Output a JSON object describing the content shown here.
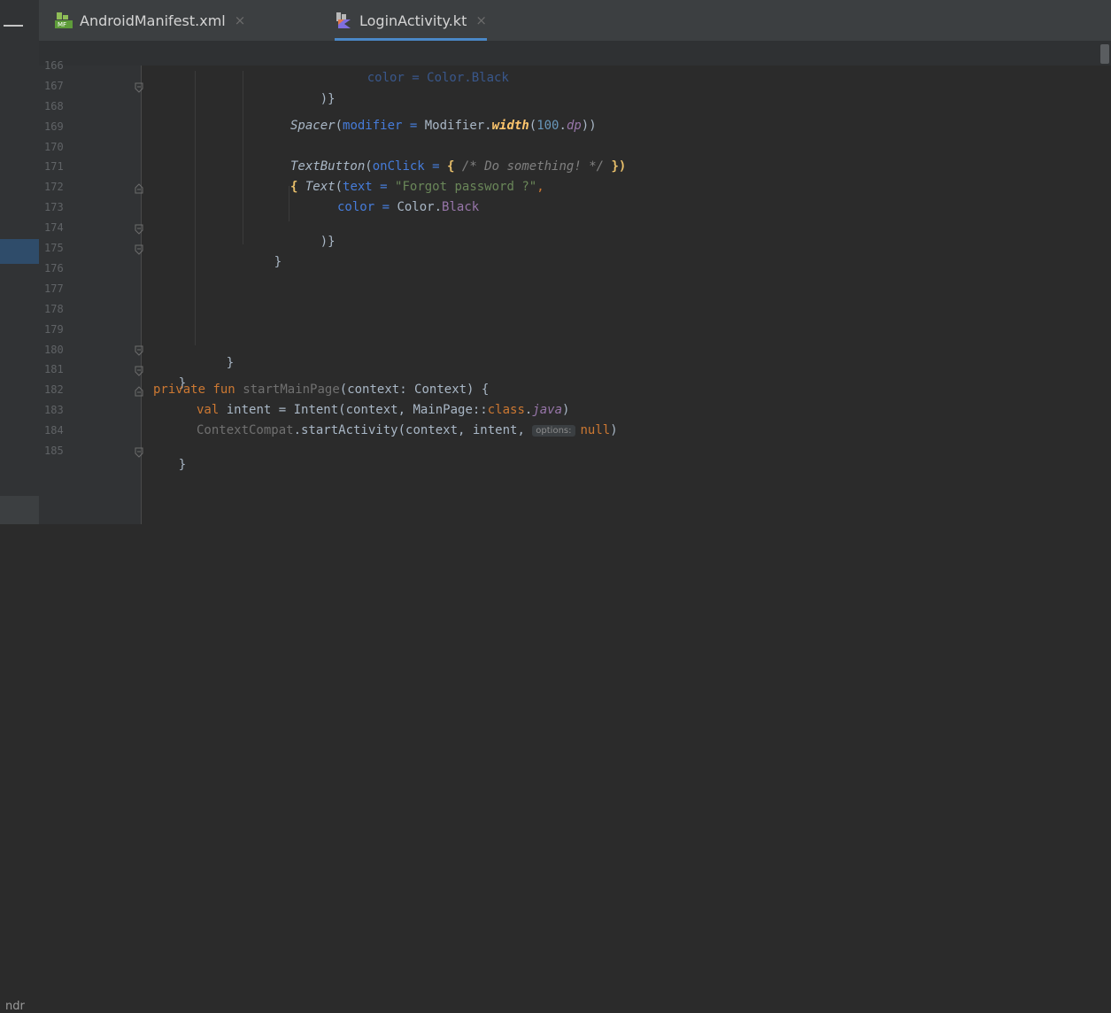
{
  "tabs": [
    {
      "label": "AndroidManifest.xml",
      "icon": "manifest-file-icon",
      "active": false
    },
    {
      "label": "LoginActivity.kt",
      "icon": "kotlin-file-icon",
      "active": true
    }
  ],
  "tab_close_glyph": "×",
  "left_strip_label": "ndr",
  "line_numbers": [
    "166",
    "167",
    "168",
    "169",
    "170",
    "171",
    "172",
    "173",
    "174",
    "175",
    "176",
    "177",
    "178",
    "179",
    "180",
    "181",
    "182",
    "183",
    "184",
    "185"
  ],
  "code": {
    "l166": "color = Color.Black",
    "l167": ")}",
    "l169": {
      "fn": "Spacer",
      "p1": "(",
      "param": "modifier",
      "eq": " = ",
      "obj": "Modifier.",
      "ext": "width",
      "p2": "(",
      "num": "100",
      "dot": ".",
      "prop": "dp",
      "close": "))"
    },
    "l171": {
      "fn": "TextButton",
      "p1": "(",
      "param": "onClick",
      "eq": " = ",
      "brace": "{",
      "comment": " /* Do something! */ ",
      "brace2": "})"
    },
    "l172": {
      "brace": "{ ",
      "fn": "Text",
      "p1": "(",
      "param": "text",
      "eq": " = ",
      "str": "\"Forgot password ?\"",
      "comma": ","
    },
    "l173": {
      "param": "color",
      "eq": " = ",
      "obj": "Color.",
      "prop": "Black"
    },
    "l174": ")}",
    "l175": "}",
    "l180": "}",
    "l181": "}",
    "l182": {
      "kw1": "private",
      "kw2": "fun",
      "name": "startMainPage",
      "rest": "(context: Context) {"
    },
    "l183": {
      "kw": "val",
      "rest1": " intent = Intent(context, MainPage::",
      "kw2": "class",
      "dot": ".",
      "prop": "java",
      "close": ")"
    },
    "l184": {
      "obj": "ContextCompat",
      "rest": ".startActivity(context, intent, ",
      "hint": "options:",
      "kw": "null",
      "close": ")"
    },
    "l185": "}"
  },
  "colors": {
    "background": "#2b2b2b",
    "gutter": "#313335",
    "tabbar": "#3c3f41",
    "accent": "#4a88c7"
  }
}
